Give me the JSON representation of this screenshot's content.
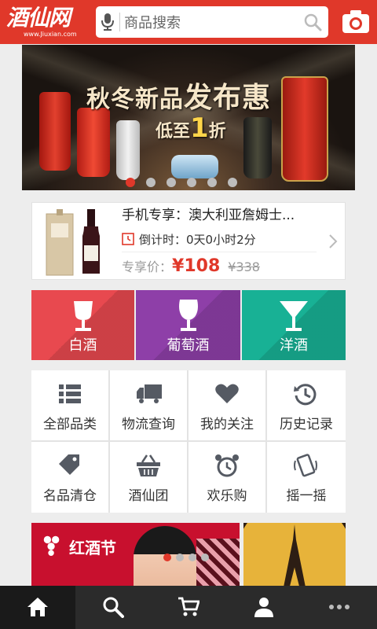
{
  "header": {
    "logo_cn": "酒仙网",
    "logo_en": "www.Jiuxian.com",
    "search_placeholder": "商品搜索"
  },
  "banner": {
    "headline_a": "秋冬新品",
    "headline_b": "发布惠",
    "sub_a": "低至",
    "sub_num": "1",
    "sub_b": "折",
    "slide_count": 6,
    "active_slide": 1
  },
  "deal": {
    "name": "手机专享：澳大利亚詹姆士...",
    "countdown_label": "倒计时：",
    "countdown_value": "0天0小时2分",
    "price_label": "专享价：",
    "price": "¥108",
    "old_price": "¥338"
  },
  "categories": [
    {
      "label": "白酒",
      "color": "#e8494f",
      "icon": "wine-glass-icon"
    },
    {
      "label": "葡萄酒",
      "color": "#8e3fa8",
      "icon": "red-wine-glass-icon"
    },
    {
      "label": "洋酒",
      "color": "#18b195",
      "icon": "cocktail-glass-icon"
    }
  ],
  "shortcuts": [
    {
      "label": "全部品类",
      "icon": "list-icon"
    },
    {
      "label": "物流查询",
      "icon": "truck-icon"
    },
    {
      "label": "我的关注",
      "icon": "heart-icon"
    },
    {
      "label": "历史记录",
      "icon": "history-icon"
    },
    {
      "label": "名品清仓",
      "icon": "tag-icon"
    },
    {
      "label": "酒仙团",
      "icon": "basket-icon"
    },
    {
      "label": "欢乐购",
      "icon": "alarm-clock-icon"
    },
    {
      "label": "摇一摇",
      "icon": "shake-phone-icon"
    }
  ],
  "promo": {
    "left_title": "红酒节"
  },
  "tabbar": {
    "tabs": [
      "home-icon",
      "search-icon",
      "cart-icon",
      "user-icon",
      "more-icon"
    ],
    "active": 0
  },
  "colors": {
    "brand_red": "#e0382a",
    "price_red": "#e0382a",
    "tabbar_bg": "#2b2b2b",
    "icon_gray": "#555a63"
  }
}
